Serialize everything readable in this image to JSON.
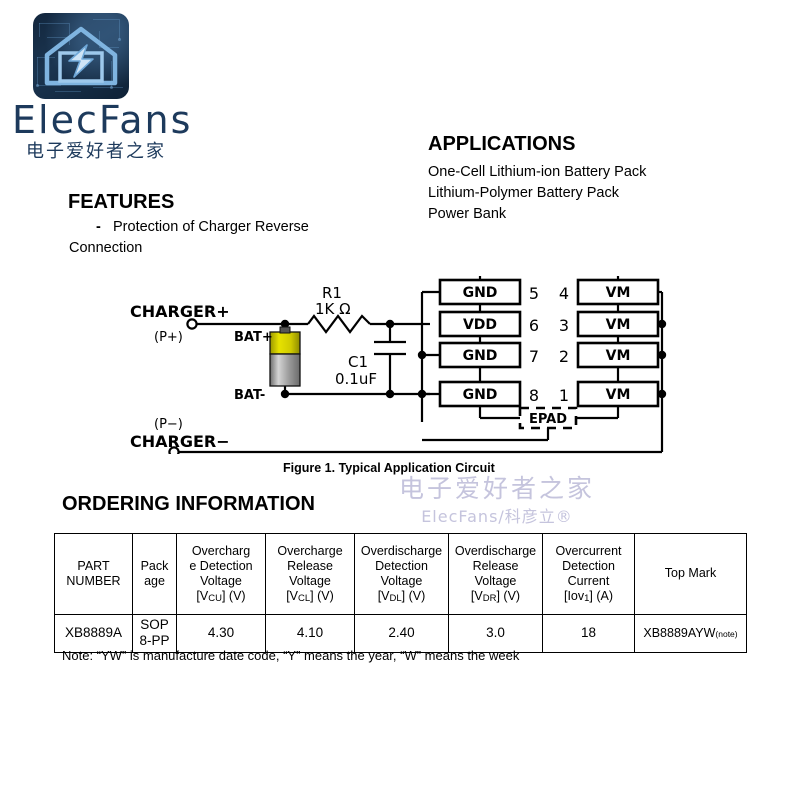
{
  "logo": {
    "wordmark": "ElecFans",
    "subtitle": "电子爱好者之家",
    "icon": "house-lightning-logo",
    "brand_color": "#1d3a5c",
    "badge_bg": "#12263d"
  },
  "sections": {
    "features": {
      "heading": "FEATURES",
      "bullet_dash": "-",
      "items_line1": "Protection of  Charger Reverse",
      "items_line2": "Connection"
    },
    "applications": {
      "heading": "APPLICATIONS",
      "items": [
        "One-Cell Lithium-ion Battery Pack",
        "Lithium-Polymer Battery Pack",
        "Power Bank"
      ]
    },
    "ordering": {
      "heading": "ORDERING INFORMATION"
    }
  },
  "figure": {
    "caption": "Figure 1.  Typical Application Circuit",
    "labels": {
      "charger_plus": "CHARGER+",
      "p_plus": "(P+)",
      "charger_minus": "CHARGER−",
      "p_minus": "(P−)",
      "bat_plus": "BAT+",
      "bat_minus": "BAT-",
      "r1_name": "R1",
      "r1_value": "1K Ω",
      "c1_name": "C1",
      "c1_value": "0.1uF",
      "epad": "EPAD"
    },
    "left_pins": [
      {
        "number": "5",
        "name": "GND"
      },
      {
        "number": "6",
        "name": "VDD"
      },
      {
        "number": "7",
        "name": "GND"
      },
      {
        "number": "8",
        "name": "GND"
      }
    ],
    "right_pins": [
      {
        "number": "4",
        "name": "VM"
      },
      {
        "number": "3",
        "name": "VM"
      },
      {
        "number": "2",
        "name": "VM"
      },
      {
        "number": "1",
        "name": "VM"
      }
    ],
    "battery_colors": {
      "top": "#d8d400",
      "body": "#9a9a9a"
    }
  },
  "watermark": {
    "cn": "电子爱好者之家",
    "en": "ElecFans/科彦立®",
    "color": "#c5c4dd"
  },
  "table": {
    "columns": [
      {
        "line1": "PART",
        "line2": "NUMBER",
        "line3": "",
        "line4": ""
      },
      {
        "line1": "Pack",
        "line2": "age",
        "line3": "",
        "line4": ""
      },
      {
        "line1": "Overcharg",
        "line2": "e Detection",
        "line3": "Voltage",
        "line4": "[VCU] (V)",
        "sym": "V",
        "symsub": "CU",
        "unit": " (V)"
      },
      {
        "line1": "Overcharge",
        "line2": "Release",
        "line3": "Voltage",
        "line4": "[VCL] (V)",
        "sym": "V",
        "symsub": "CL",
        "unit": " (V)"
      },
      {
        "line1": "Overdischarge",
        "line2": "Detection",
        "line3": "Voltage",
        "line4": "[VDL] (V)",
        "sym": "V",
        "symsub": "DL",
        "unit": " (V)"
      },
      {
        "line1": "Overdischarge",
        "line2": "Release",
        "line3": "Voltage",
        "line4": "[VDR] (V)",
        "sym": "V",
        "symsub": "DR",
        "unit": " (V)"
      },
      {
        "line1": "Overcurrent",
        "line2": "Detection",
        "line3": "Current",
        "line4": "[Iov1] (A)",
        "sym": "Iov",
        "symsub": "1",
        "unit": " (A)"
      },
      {
        "line1": "Top Mark",
        "line2": "",
        "line3": "",
        "line4": ""
      }
    ],
    "rows": [
      {
        "part_number": "XB8889A",
        "package_line1": "SOP",
        "package_line2": "8-PP",
        "overcharge_detection_voltage": "4.30",
        "overcharge_release_voltage": "4.10",
        "overdischarge_detection_voltage": "2.40",
        "overdischarge_release_voltage": "3.0",
        "overcurrent_detection_current": "18",
        "top_mark": "XB8889AYW",
        "top_mark_note": "(note)"
      }
    ],
    "note": "Note: “YW” is manufacture date code, “Y” means the year, “W” means the week"
  }
}
